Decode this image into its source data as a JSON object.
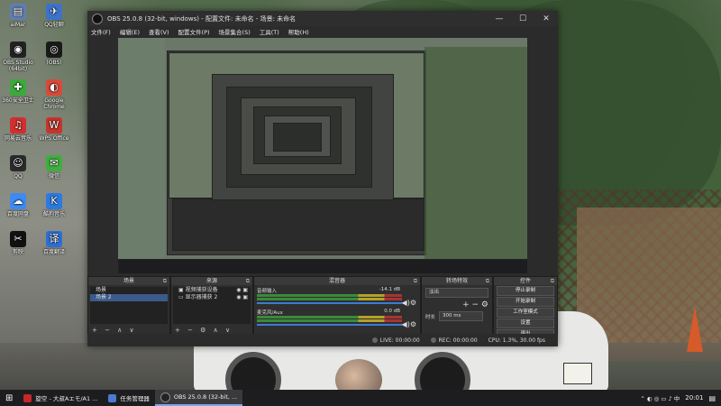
{
  "desktop_icons": [
    {
      "label": "aiMar",
      "icon": "notes-icon",
      "color": "#5f7fb0",
      "glyph": "▤"
    },
    {
      "label": "QQ轻聊",
      "icon": "bird-icon",
      "color": "#3c72c9",
      "glyph": "✈"
    },
    {
      "label": "OBS Studio\n(64bit)",
      "icon": "obs-icon",
      "color": "#222222",
      "glyph": "◉"
    },
    {
      "label": "(OBS)",
      "icon": "obs-icon",
      "color": "#1a1a1a",
      "glyph": "◎"
    },
    {
      "label": "360安全卫士",
      "icon": "shield-icon",
      "color": "#3aaa3a",
      "glyph": "✚"
    },
    {
      "label": "Google Chrome",
      "icon": "chrome-icon",
      "color": "#d84a38",
      "glyph": "◐"
    },
    {
      "label": "网易云音乐",
      "icon": "music-icon",
      "color": "#d32f2f",
      "glyph": "♫"
    },
    {
      "label": "WPS Office",
      "icon": "wps-icon",
      "color": "#c8342b",
      "glyph": "W"
    },
    {
      "label": "QQ",
      "icon": "penguin-icon",
      "color": "#2b2b2b",
      "glyph": "☺"
    },
    {
      "label": "微信",
      "icon": "wechat-icon",
      "color": "#3fae3f",
      "glyph": "✉"
    },
    {
      "label": "百度网盘",
      "icon": "cloud-icon",
      "color": "#3d8bf0",
      "glyph": "☁"
    },
    {
      "label": "酷狗音乐",
      "icon": "kugou-icon",
      "color": "#2a7ae0",
      "glyph": "K"
    },
    {
      "label": "剪映",
      "icon": "scissors-icon",
      "color": "#111111",
      "glyph": "✂"
    },
    {
      "label": "百度翻译",
      "icon": "translate-icon",
      "color": "#2e6fd2",
      "glyph": "译"
    }
  ],
  "obs": {
    "title": "OBS 25.0.8 (32-bit, windows) - 配置文件: 未命名 - 场景: 未命名",
    "window_buttons": {
      "minimize": "—",
      "maximize": "☐",
      "close": "✕"
    },
    "menu": [
      "文件(F)",
      "编辑(E)",
      "查看(V)",
      "配置文件(P)",
      "场景集合(S)",
      "工具(T)",
      "帮助(H)"
    ],
    "docks": {
      "scenes": {
        "title": "场景",
        "items": [
          "场景",
          "场景 2"
        ],
        "toolbar": "+ − ∧ ∨"
      },
      "sources": {
        "title": "来源",
        "items": [
          "视频捕获设备",
          "显示器捕获 2"
        ],
        "toolbar": "+ − ⚙ ∧ ∨"
      },
      "mixer": {
        "title": "混音器",
        "channels": [
          {
            "name": "音频输入",
            "db": "-14.1 dB"
          },
          {
            "name": "麦克风/Aux",
            "db": "0.0 dB"
          }
        ]
      },
      "transitions": {
        "title": "转场特效",
        "type": "淡出",
        "duration_label": "时长",
        "duration": "300 ms"
      },
      "controls": {
        "title": "控件",
        "buttons": [
          "停止录制",
          "开始录制",
          "工作室模式",
          "设置",
          "退出"
        ]
      }
    },
    "status": {
      "live": "LIVE: 00:00:00",
      "rec": "REC: 00:00:00",
      "cpu": "CPU: 1.3%, 30.00 fps"
    }
  },
  "taskbar": {
    "items": [
      {
        "label": "旋空 - 大叔Aエモ/A1 ...",
        "color": "#c62828"
      },
      {
        "label": "任务管理器",
        "color": "#4a7bd0"
      },
      {
        "label": "OBS 25.0.8 (32-bit, ...",
        "color": "#222222",
        "active": true
      }
    ],
    "tray_icons": "⌃ ◐ ◎ ▭ ♪ 中",
    "clock": "20:01"
  }
}
